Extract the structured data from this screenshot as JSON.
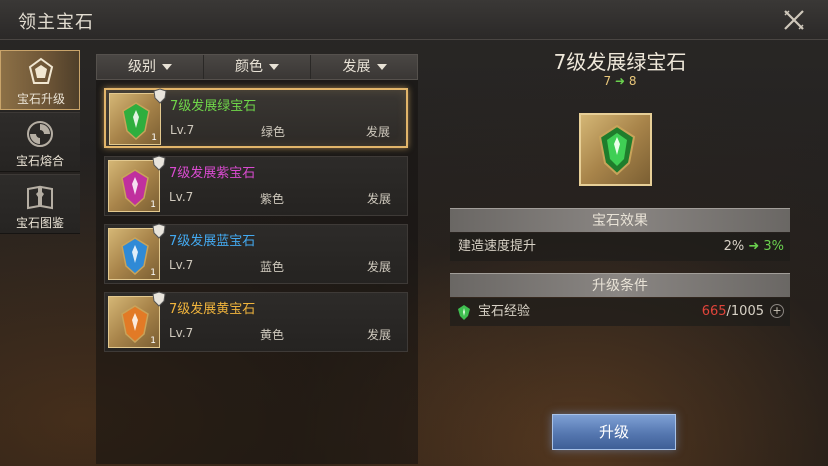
{
  "window": {
    "title": "领主宝石"
  },
  "nav": {
    "items": [
      {
        "label": "宝石升级",
        "icon": "gem-upgrade-icon",
        "active": true
      },
      {
        "label": "宝石熔合",
        "icon": "gem-fusion-icon",
        "active": false
      },
      {
        "label": "宝石图鉴",
        "icon": "gem-codex-icon",
        "active": false
      }
    ]
  },
  "filters": {
    "level": "级别",
    "color": "颜色",
    "development": "发展"
  },
  "gems": [
    {
      "name": "7级发展绿宝石",
      "level": "Lv.7",
      "color": "绿色",
      "type": "发展",
      "count": "1",
      "name_color": "#6fd64a",
      "gem_color": "#2fae3e",
      "selected": true
    },
    {
      "name": "7级发展紫宝石",
      "level": "Lv.7",
      "color": "紫色",
      "type": "发展",
      "count": "1",
      "name_color": "#d94bd0",
      "gem_color": "#c0309e",
      "selected": false
    },
    {
      "name": "7级发展蓝宝石",
      "level": "Lv.7",
      "color": "蓝色",
      "type": "发展",
      "count": "1",
      "name_color": "#43a9f0",
      "gem_color": "#2f8ad6",
      "selected": false
    },
    {
      "name": "7级发展黄宝石",
      "level": "Lv.7",
      "color": "黄色",
      "type": "发展",
      "count": "1",
      "name_color": "#f0b43c",
      "gem_color": "#e27a26",
      "selected": false
    }
  ],
  "detail": {
    "title": "7级发展绿宝石",
    "level_from": "7",
    "level_to": "8",
    "effect_header": "宝石效果",
    "effect_label": "建造速度提升",
    "effect_from": "2%",
    "effect_to": "3%",
    "condition_header": "升级条件",
    "condition_label": "宝石经验",
    "exp_current": "665",
    "exp_required": "/1005",
    "upgrade_label": "升级"
  },
  "colors": {
    "accent_gold": "#e2b56a",
    "exp_red": "#e0443a",
    "increase_green": "#6ad04e",
    "button_blue": "#5577b0"
  }
}
